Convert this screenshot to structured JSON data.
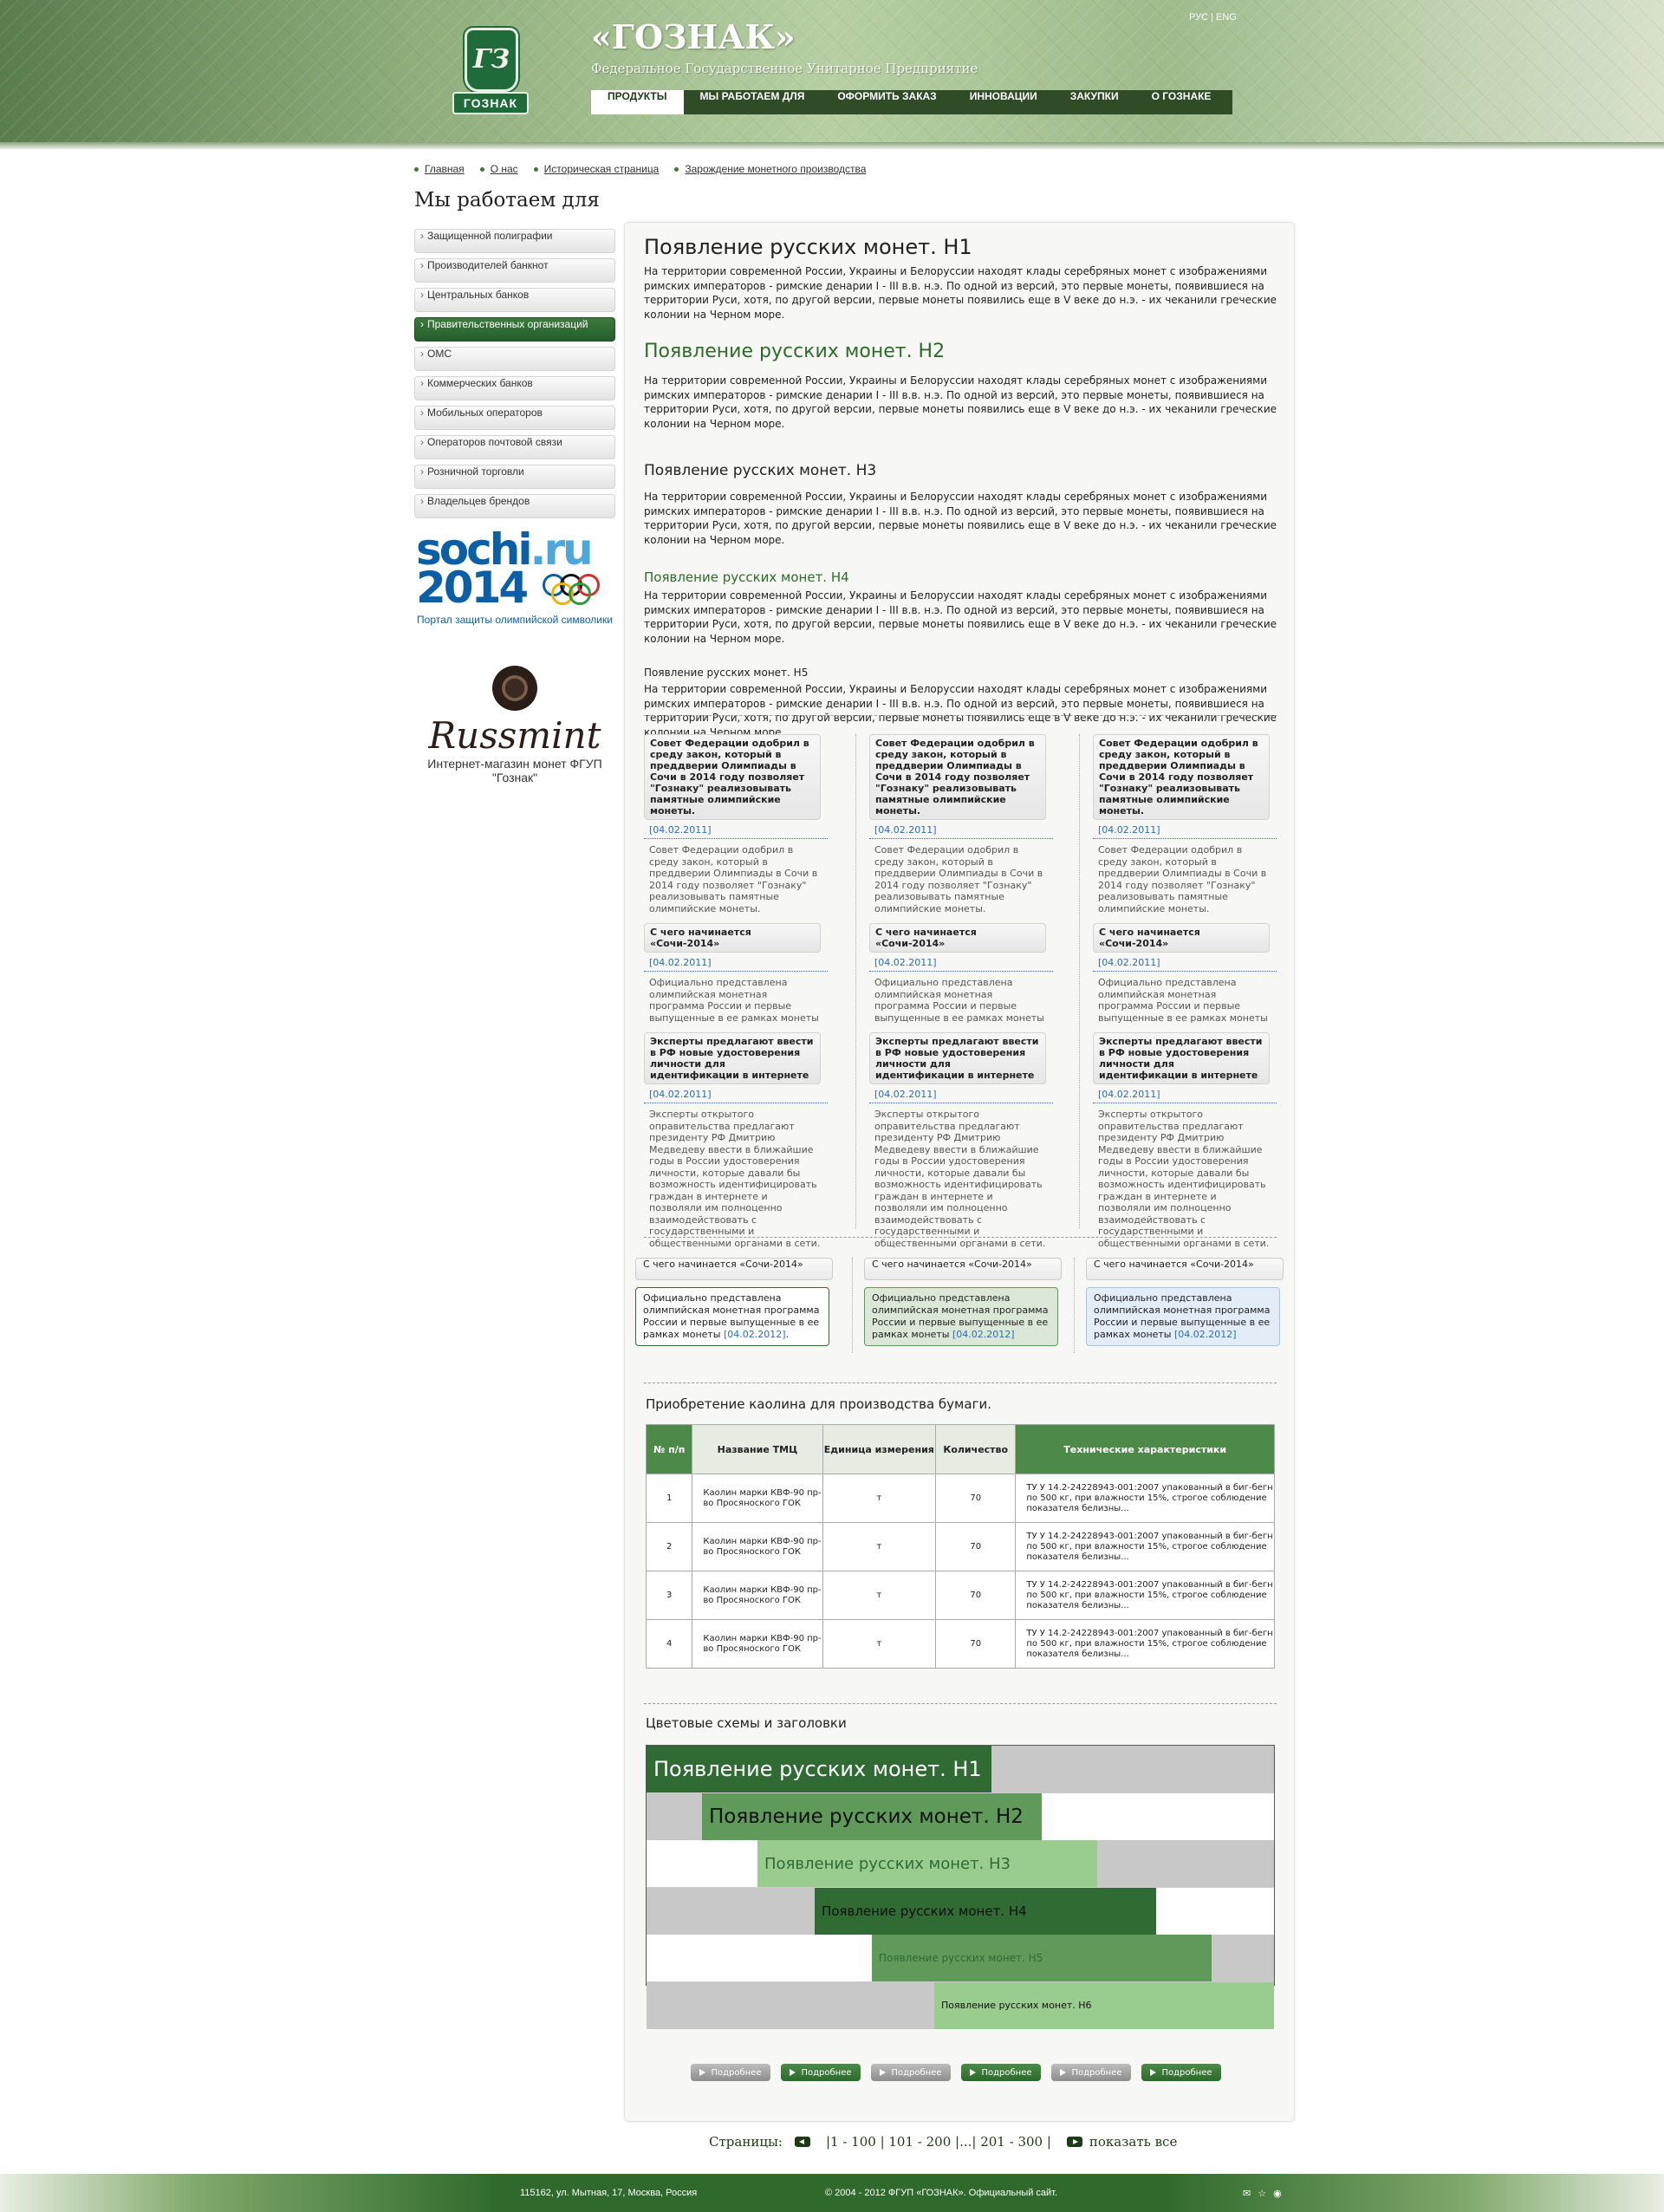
{
  "header": {
    "title": "«ГОЗНАК»",
    "subtitle": "Федеральное Государственное Унитарное Предприятие",
    "logo_text": "ГОЗНАК",
    "logo_monogram": "ГЗ",
    "lang_ru": "РУС",
    "lang_sep": " | ",
    "lang_en": "ENG",
    "nav": [
      "ПРОДУКТЫ",
      "МЫ РАБОТАЕМ ДЛЯ",
      "ОФОРМИТЬ ЗАКАЗ",
      "ИННОВАЦИИ",
      "ЗАКУПКИ",
      "О ГОЗНАКЕ"
    ]
  },
  "breadcrumbs": [
    "Главная",
    "О нас",
    "Историческая страница",
    "Зарождение монетного производства"
  ],
  "page_title": "Мы работаем для",
  "sidebar": {
    "items": [
      "Защищенной полиграфии",
      "Производителей банкнот",
      "Центральных банков",
      "Правительственных организаций",
      "ОМС",
      "Коммерческих банков",
      "Мобильных операторов",
      "Операторов почтовой связи",
      "Розничной торговли",
      "Владельцев брендов"
    ],
    "active_index": 3,
    "sochi_word_1": "sochi",
    "sochi_word_2": ".ru",
    "sochi_word_3": "2014",
    "sochi_caption": "Портал защиты олимпийской символики",
    "russmint_brand": "Russmint",
    "russmint_caption": "Интернет-магазин монет ФГУП \"Гознак\""
  },
  "headings": {
    "h1": "Появление русских монет. H1",
    "h2": "Появление русских монет. H2",
    "h3": "Появление русских монет. H3",
    "h4": "Появление русских монет. H4",
    "h5": "Появление русских монет. H5"
  },
  "paragraph": "На территории современной России, Украины и Белоруссии находят клады серебряных монет с изображениями римских императоров - римские денарии I - III в.в. н.э. По одной из версий, это первые монеты, появившиеся на территории Руси, хотя, по другой версии, первые монеты появились еще в V веке до н.э. - их чеканили греческие колонии на Черном море.",
  "news": {
    "t1": "Совет Федерации одобрил в среду закон, который в преддверии Олимпиады в Сочи в 2014 году позволяет \"Гознаку\" реализовывать памятные олимпийские монеты.",
    "d": "[04.02.2011]",
    "x1": "Совет Федерации одобрил в среду закон, который в преддверии Олимпиады в Сочи в 2014 году позволяет \"Гознаку\" реализовывать памятные олимпийские монеты.",
    "t2": "С чего начинается «Сочи-2014»",
    "x2": "Официально представлена олимпийская монетная программа России и первые выпущенные в ее рамках монеты",
    "t3": "Эксперты предлагают ввести в РФ новые удостоверения личности для идентификации в интернете",
    "x3": "Эксперты открытого оправительства предлагают президенту РФ Дмитрию Медведеву ввести в ближайшие годы в России удостоверения личности, которые давали бы возможность идентифицировать граждан в интернете и позволяли им полноценно взаимодействовать с государственными и общественными органами в сети."
  },
  "boxes": {
    "title": "С чего начинается «Сочи-2014»",
    "text": "Официально представлена олимпийская монетная программа России и первые выпущенные в ее рамках монеты",
    "date": "[04.02.2012]",
    "dot": "."
  },
  "table": {
    "title": "Приобретение каолина для производства бумаги.",
    "headers": [
      "№ п/п",
      "Название ТМЦ",
      "Единица измерения",
      "Количество",
      "Технические характеристики"
    ],
    "rows": [
      {
        "n": "1",
        "name": "Каолин марки КВФ-90 пр-во Просяноского ГОК",
        "unit": "т",
        "qty": "70",
        "spec": "ТУ У 14.2-24228943-001:2007 упакованный в биг-бегн по 500 кг, при влажности 15%, строгое соблюдение показателя белизны..."
      },
      {
        "n": "2",
        "name": "Каолин марки КВФ-90 пр-во Просяноского ГОК",
        "unit": "т",
        "qty": "70",
        "spec": "ТУ У 14.2-24228943-001:2007 упакованный в биг-бегн по 500 кг, при влажности 15%, строгое соблюдение показателя белизны..."
      },
      {
        "n": "3",
        "name": "Каолин марки КВФ-90 пр-во Просяноского ГОК",
        "unit": "т",
        "qty": "70",
        "spec": "ТУ У 14.2-24228943-001:2007 упакованный в биг-бегн по 500 кг, при влажности 15%, строгое соблюдение показателя белизны..."
      },
      {
        "n": "4",
        "name": "Каолин марки КВФ-90 пр-во Просяноского ГОК",
        "unit": "т",
        "qty": "70",
        "spec": "ТУ У 14.2-24228943-001:2007 упакованный в биг-бегн по 500 кг, при влажности 15%, строгое соблюдение показателя белизны..."
      }
    ]
  },
  "schemes": {
    "title": "Цветовые схемы и заголовки",
    "rows": [
      "Появление русских монет. H1",
      "Появление русских монет. H2",
      "Появление русских монет. H3",
      "Появление русских монет. H4",
      "Появление русских монет. H5",
      "Появление русских монет. H6"
    ],
    "colors": {
      "dark": "#2f6b32",
      "mid": "#5f9a5a",
      "light": "#9acc90",
      "gray": "#c8c8c8",
      "white": "#ffffff"
    }
  },
  "buttons": {
    "label": "Подробнее",
    "styles": [
      "gray",
      "green",
      "gray",
      "green",
      "gray",
      "green"
    ]
  },
  "pager": {
    "label": "Страницы:",
    "ranges": "|1 - 100 | 101 - 200 |...| 201 - 300 |",
    "show_all": "показать все"
  },
  "footer": {
    "address": "115162, ул. Мытная, 17, Москва, Россия",
    "copyright": "© 2004 - 2012 ФГУП «ГОЗНАК». Официальный сайт.",
    "icons": [
      "mail-icon",
      "star-icon",
      "rss-icon"
    ]
  }
}
